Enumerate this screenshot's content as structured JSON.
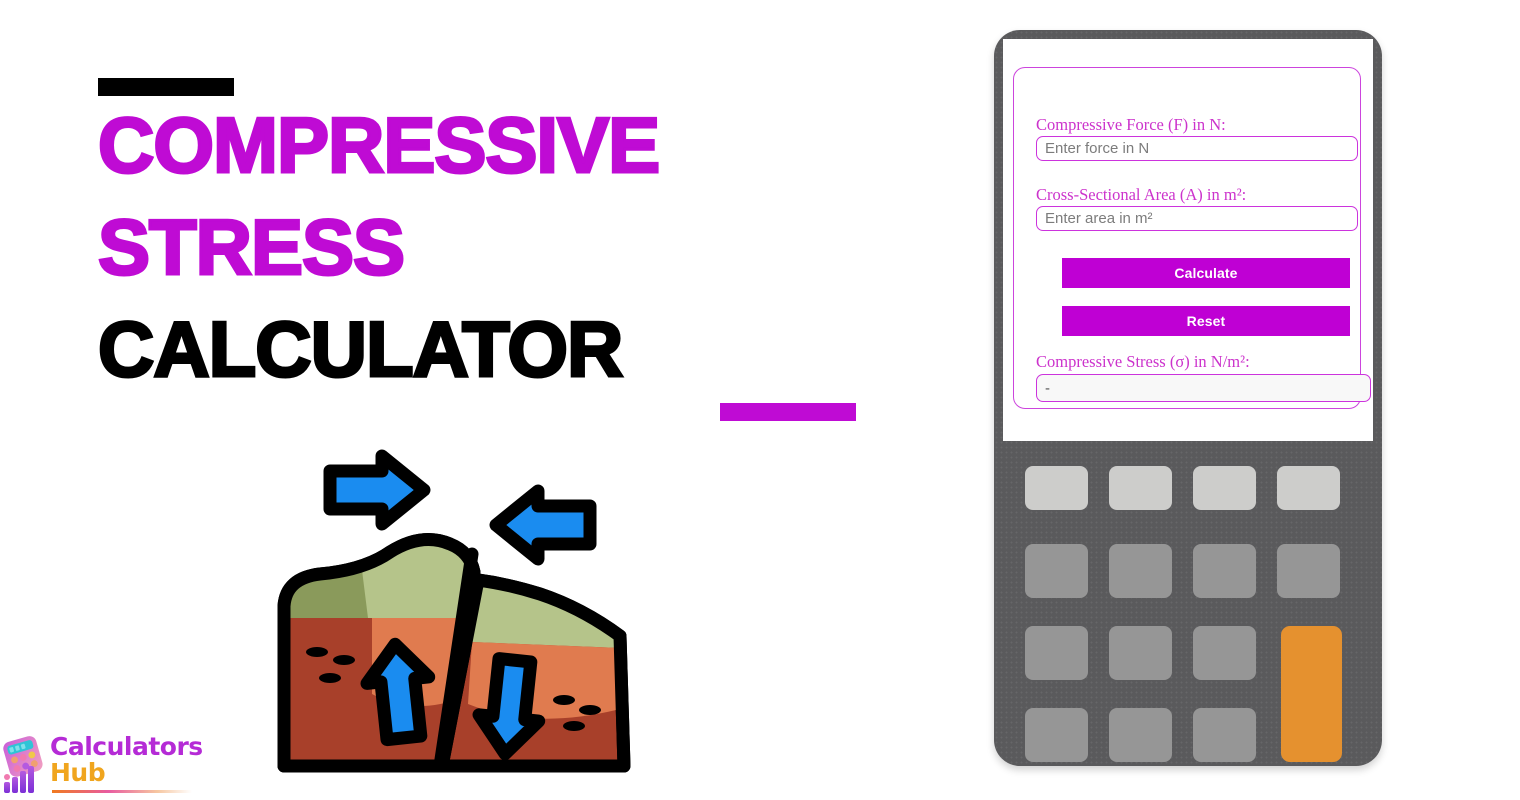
{
  "page": {
    "background_color": "#ffffff",
    "accent_magenta": "#bf0bd4",
    "accent_black": "#000000",
    "accent_orange": "#e5912f"
  },
  "title": {
    "line1": "Compressive",
    "line2": "Stress",
    "line3": "Calculator",
    "line1_color": "#bf0bd4",
    "line2_color": "#bf0bd4",
    "line3_color": "#000000",
    "rule_top_color": "#000000",
    "rule_bottom_color": "#bf0bd4"
  },
  "illustration": {
    "name": "tectonic-fault-compression-icon",
    "description": "Cross-section of ground with a fault, two blue horizontal arrows pressing inward and two blue vertical arrows inside the blocks",
    "colors": {
      "arrow_blue": "#1a8cf0",
      "outline_black": "#000000",
      "grass_light": "#b5c48a",
      "grass_dark": "#8a9a5b",
      "soil_light": "#e07b4f",
      "soil_dark": "#a8402a"
    }
  },
  "brand": {
    "word1": "Calculators",
    "word2": "Hub",
    "word1_color": "#b52bd6",
    "word2_color": "#f0a51e",
    "mark_name": "calculator-bars-logo-icon"
  },
  "calculator": {
    "device_color": "#5a5a5c",
    "screen_color": "#ffffff",
    "card_border_color": "#cc44dd",
    "form": {
      "fields": [
        {
          "id": "force",
          "label": "Compressive Force (F) in N:",
          "placeholder": "Enter force in N",
          "value": ""
        },
        {
          "id": "area",
          "label": "Cross-Sectional Area (A) in m²:",
          "placeholder": "Enter area in m²",
          "value": ""
        }
      ],
      "buttons": {
        "calculate": "Calculate",
        "reset": "Reset",
        "color": "#bf00d4",
        "text_color": "#ffffff"
      },
      "result": {
        "label": "Compressive Stress (σ) in N/m²:",
        "value": "-"
      }
    },
    "keypad": {
      "rows": 4,
      "columns": 4,
      "row1_key_color": "#cdcdcb",
      "other_key_color": "#969696",
      "accent_key_color": "#e5912f",
      "accent_key_name": "equals-key",
      "keys": [
        {
          "name": "key-r1c1",
          "row": 1,
          "col": 1,
          "style": "light"
        },
        {
          "name": "key-r1c2",
          "row": 1,
          "col": 2,
          "style": "light"
        },
        {
          "name": "key-r1c3",
          "row": 1,
          "col": 3,
          "style": "light"
        },
        {
          "name": "key-r1c4",
          "row": 1,
          "col": 4,
          "style": "light"
        },
        {
          "name": "key-r2c1",
          "row": 2,
          "col": 1,
          "style": "mid"
        },
        {
          "name": "key-r2c2",
          "row": 2,
          "col": 2,
          "style": "mid"
        },
        {
          "name": "key-r2c3",
          "row": 2,
          "col": 3,
          "style": "mid"
        },
        {
          "name": "key-r2c4",
          "row": 2,
          "col": 4,
          "style": "mid"
        },
        {
          "name": "key-r3c1",
          "row": 3,
          "col": 1,
          "style": "mid"
        },
        {
          "name": "key-r3c2",
          "row": 3,
          "col": 2,
          "style": "mid"
        },
        {
          "name": "key-r3c3",
          "row": 3,
          "col": 3,
          "style": "mid"
        },
        {
          "name": "key-r4c1",
          "row": 4,
          "col": 1,
          "style": "mid"
        },
        {
          "name": "key-r4c2",
          "row": 4,
          "col": 2,
          "style": "mid"
        },
        {
          "name": "key-r4c3",
          "row": 4,
          "col": 3,
          "style": "mid"
        },
        {
          "name": "equals-key",
          "row": 3,
          "col": 4,
          "style": "accent",
          "span_rows": 2
        }
      ]
    }
  }
}
